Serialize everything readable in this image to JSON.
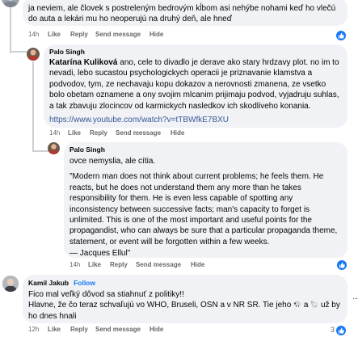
{
  "comment1": {
    "text": "ja neviem, ale človek s postreleným bedrovým kĺbom asi nehýbe nohami keď ho vlečú do auta a lekári mu ho neoperujú na druhý deň, ale hneď",
    "time": "14h",
    "like": "Like",
    "reply": "Reply",
    "send": "Send message",
    "hide": "Hide"
  },
  "reply1": {
    "author": "Palo Singh",
    "mention": "Katarína Kuliková",
    "text": " ano, cele to divadlo je derave ako stary hrdzavy plot. no im to nevadi, lebo sucastou psychologickych operacii je priznavanie klamstva a podvodov, tym, ze nechavaju kopu dokazov a nerovnosti zmanena, ze vsetko bolo obetam oznamene a ony svojim mlcanim prijimaju podvod, vyjadruju suhlas, a tak zbavuju zlocincov od karmickych nasledkov ich skodliveho konania.",
    "link": "https://www.youtube.com/watch?v=tTBWfkE7BXU",
    "time": "14h",
    "like": "Like",
    "reply": "Reply",
    "send": "Send message",
    "hide": "Hide"
  },
  "reply2": {
    "author": "Palo Singh",
    "line1": "ovce nemyslia, ale cítia.",
    "quote": "\"Modern man does not think about current problems; he feels them. He reacts, but he does not understand them any more than he takes responsibility for them. He is even less capable of spotting any inconsistency between successive facts; man's capacity to forget is unlimited. This is one of the most important and useful points for the propagandist, who can always be sure that a particular propaganda theme, statement, or event will be forgotten within a few weeks.",
    "signature": "— Jacques Ellul\"",
    "time": "14h",
    "like": "Like",
    "reply": "Reply",
    "send": "Send message",
    "hide": "Hide"
  },
  "comment2": {
    "author": "Kamil Jakub",
    "follow": "Follow",
    "line1": "Fico mal veľký dôvod sa stiahnuť z politiky!!",
    "line2a": "Hlavne, že čo teraz schvaľujú vo WHO, Bruseli, OSN a v NR SR. Tie jeho ",
    "line2b": " a ",
    "line2c": " už by ho dnes hnali",
    "time": "12h",
    "like": "Like",
    "reply": "Reply",
    "send": "Send message",
    "hide": "Hide",
    "reaction_count": "3",
    "more": "..."
  },
  "colors": {
    "bubble": "#f0f2f5",
    "accent": "#1877f2",
    "link": "#385898",
    "meta": "#65676b"
  }
}
